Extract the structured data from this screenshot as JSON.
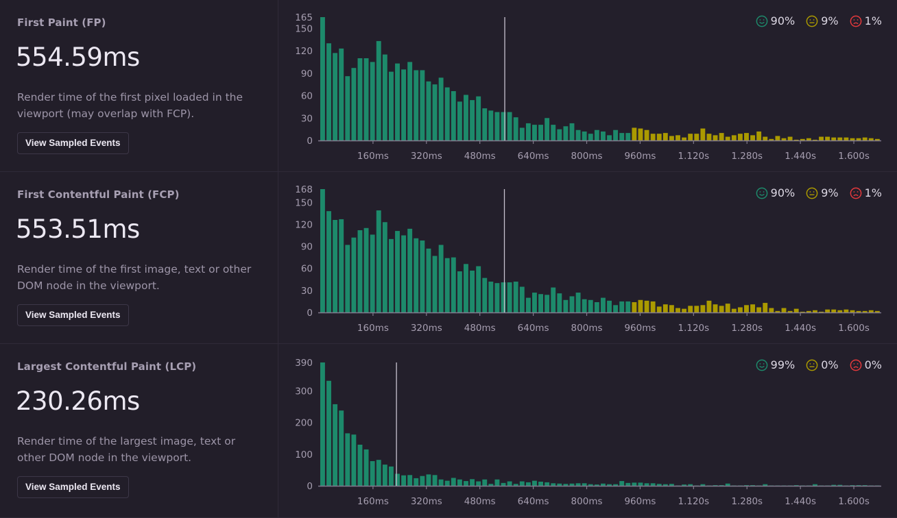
{
  "colors": {
    "good": "#1d8a6b",
    "meh": "#ab9a00",
    "poor": "#e5393c",
    "marker": "#c8c2d0",
    "axis": "#827a8d"
  },
  "metrics": [
    {
      "name": "First Paint (FP)",
      "value": "554.59ms",
      "description": "Render time of the first pixel loaded in the viewport (may overlap with FCP).",
      "button_label": "View Sampled Events",
      "legend": [
        {
          "icon": "happy-face-icon",
          "label": "90%",
          "status": "good"
        },
        {
          "icon": "neutral-face-icon",
          "label": "9%",
          "status": "meh"
        },
        {
          "icon": "sad-face-icon",
          "label": "1%",
          "status": "poor"
        }
      ]
    },
    {
      "name": "First Contentful Paint (FCP)",
      "value": "553.51ms",
      "description": "Render time of the first image, text or other DOM node in the viewport.",
      "button_label": "View Sampled Events",
      "legend": [
        {
          "icon": "happy-face-icon",
          "label": "90%",
          "status": "good"
        },
        {
          "icon": "neutral-face-icon",
          "label": "9%",
          "status": "meh"
        },
        {
          "icon": "sad-face-icon",
          "label": "1%",
          "status": "poor"
        }
      ]
    },
    {
      "name": "Largest Contentful Paint (LCP)",
      "value": "230.26ms",
      "description": "Render time of the largest image, text or other DOM node in the viewport.",
      "button_label": "View Sampled Events",
      "legend": [
        {
          "icon": "happy-face-icon",
          "label": "99%",
          "status": "good"
        },
        {
          "icon": "neutral-face-icon",
          "label": "0%",
          "status": "meh"
        },
        {
          "icon": "sad-face-icon",
          "label": "0%",
          "status": "poor"
        }
      ]
    }
  ],
  "chart_data": [
    {
      "type": "bar",
      "title": "First Paint (FP)",
      "x_unit": "ms",
      "xlim": [
        0,
        1680
      ],
      "ylim": [
        0,
        165
      ],
      "y_ticks": [
        0,
        30,
        60,
        90,
        120,
        150,
        165
      ],
      "x_ticks": [
        {
          "value": 160,
          "label": "160ms"
        },
        {
          "value": 320,
          "label": "320ms"
        },
        {
          "value": 480,
          "label": "480ms"
        },
        {
          "value": 640,
          "label": "640ms"
        },
        {
          "value": 800,
          "label": "800ms"
        },
        {
          "value": 960,
          "label": "960ms"
        },
        {
          "value": 1120,
          "label": "1.120s"
        },
        {
          "value": 1280,
          "label": "1.280s"
        },
        {
          "value": 1440,
          "label": "1.440s"
        },
        {
          "value": 1600,
          "label": "1.600s"
        }
      ],
      "marker_value": 554.59,
      "meh_from_bin": 50,
      "grid": false,
      "values": [
        165,
        130,
        117,
        123,
        86,
        97,
        110,
        110,
        105,
        133,
        115,
        92,
        103,
        95,
        105,
        94,
        94,
        79,
        75,
        84,
        71,
        66,
        52,
        61,
        54,
        59,
        43,
        40,
        38,
        38,
        38,
        31,
        17,
        23,
        21,
        21,
        30,
        21,
        15,
        19,
        23,
        14,
        12,
        9,
        14,
        12,
        7,
        14,
        10,
        10,
        17,
        16,
        14,
        9,
        9,
        10,
        6,
        7,
        4,
        9,
        9,
        16,
        9,
        7,
        10,
        5,
        7,
        9,
        10,
        7,
        12,
        5,
        2,
        6,
        3,
        5,
        1,
        2,
        3,
        1,
        5,
        5,
        4,
        4,
        4,
        3,
        3,
        4,
        3,
        2
      ]
    },
    {
      "type": "bar",
      "title": "First Contentful Paint (FCP)",
      "x_unit": "ms",
      "xlim": [
        0,
        1680
      ],
      "ylim": [
        0,
        168
      ],
      "y_ticks": [
        0,
        30,
        60,
        90,
        120,
        150,
        168
      ],
      "x_ticks": [
        {
          "value": 160,
          "label": "160ms"
        },
        {
          "value": 320,
          "label": "320ms"
        },
        {
          "value": 480,
          "label": "480ms"
        },
        {
          "value": 640,
          "label": "640ms"
        },
        {
          "value": 800,
          "label": "800ms"
        },
        {
          "value": 960,
          "label": "960ms"
        },
        {
          "value": 1120,
          "label": "1.120s"
        },
        {
          "value": 1280,
          "label": "1.280s"
        },
        {
          "value": 1440,
          "label": "1.440s"
        },
        {
          "value": 1600,
          "label": "1.600s"
        }
      ],
      "marker_value": 553.51,
      "meh_from_bin": 50,
      "grid": false,
      "values": [
        168,
        138,
        126,
        127,
        92,
        102,
        112,
        115,
        106,
        139,
        123,
        100,
        111,
        105,
        114,
        101,
        98,
        87,
        77,
        92,
        74,
        75,
        56,
        66,
        57,
        63,
        47,
        42,
        40,
        41,
        41,
        42,
        35,
        20,
        27,
        25,
        24,
        34,
        26,
        17,
        22,
        27,
        18,
        17,
        14,
        20,
        16,
        10,
        15,
        15,
        14,
        17,
        16,
        15,
        8,
        11,
        10,
        6,
        5,
        9,
        9,
        10,
        16,
        11,
        9,
        12,
        5,
        7,
        10,
        11,
        7,
        13,
        6,
        2,
        6,
        2,
        5,
        1,
        2,
        3,
        1,
        4,
        4,
        3,
        4,
        3,
        2,
        2,
        3,
        2
      ]
    },
    {
      "type": "bar",
      "title": "Largest Contentful Paint (LCP)",
      "x_unit": "ms",
      "xlim": [
        0,
        1680
      ],
      "ylim": [
        0,
        390
      ],
      "y_ticks": [
        0,
        100,
        200,
        300,
        390
      ],
      "x_ticks": [
        {
          "value": 160,
          "label": "160ms"
        },
        {
          "value": 320,
          "label": "320ms"
        },
        {
          "value": 480,
          "label": "480ms"
        },
        {
          "value": 640,
          "label": "640ms"
        },
        {
          "value": 800,
          "label": "800ms"
        },
        {
          "value": 960,
          "label": "960ms"
        },
        {
          "value": 1120,
          "label": "1.120s"
        },
        {
          "value": 1280,
          "label": "1.280s"
        },
        {
          "value": 1440,
          "label": "1.440s"
        },
        {
          "value": 1600,
          "label": "1.600s"
        }
      ],
      "marker_value": 230.26,
      "meh_from_bin": 999,
      "grid": false,
      "values": [
        390,
        332,
        258,
        238,
        166,
        162,
        130,
        115,
        78,
        82,
        67,
        61,
        38,
        33,
        34,
        24,
        31,
        36,
        34,
        20,
        16,
        25,
        20,
        15,
        21,
        14,
        20,
        6,
        20,
        9,
        14,
        6,
        14,
        11,
        16,
        13,
        11,
        8,
        7,
        6,
        7,
        8,
        8,
        5,
        4,
        7,
        5,
        5,
        15,
        9,
        10,
        10,
        8,
        8,
        6,
        5,
        6,
        1,
        4,
        5,
        1,
        5,
        1,
        2,
        2,
        7,
        1,
        1,
        2,
        2,
        1,
        5,
        1,
        1,
        1,
        1,
        2,
        1,
        1,
        5,
        1,
        1,
        3,
        3,
        1,
        2,
        2,
        2,
        1,
        1
      ]
    }
  ]
}
